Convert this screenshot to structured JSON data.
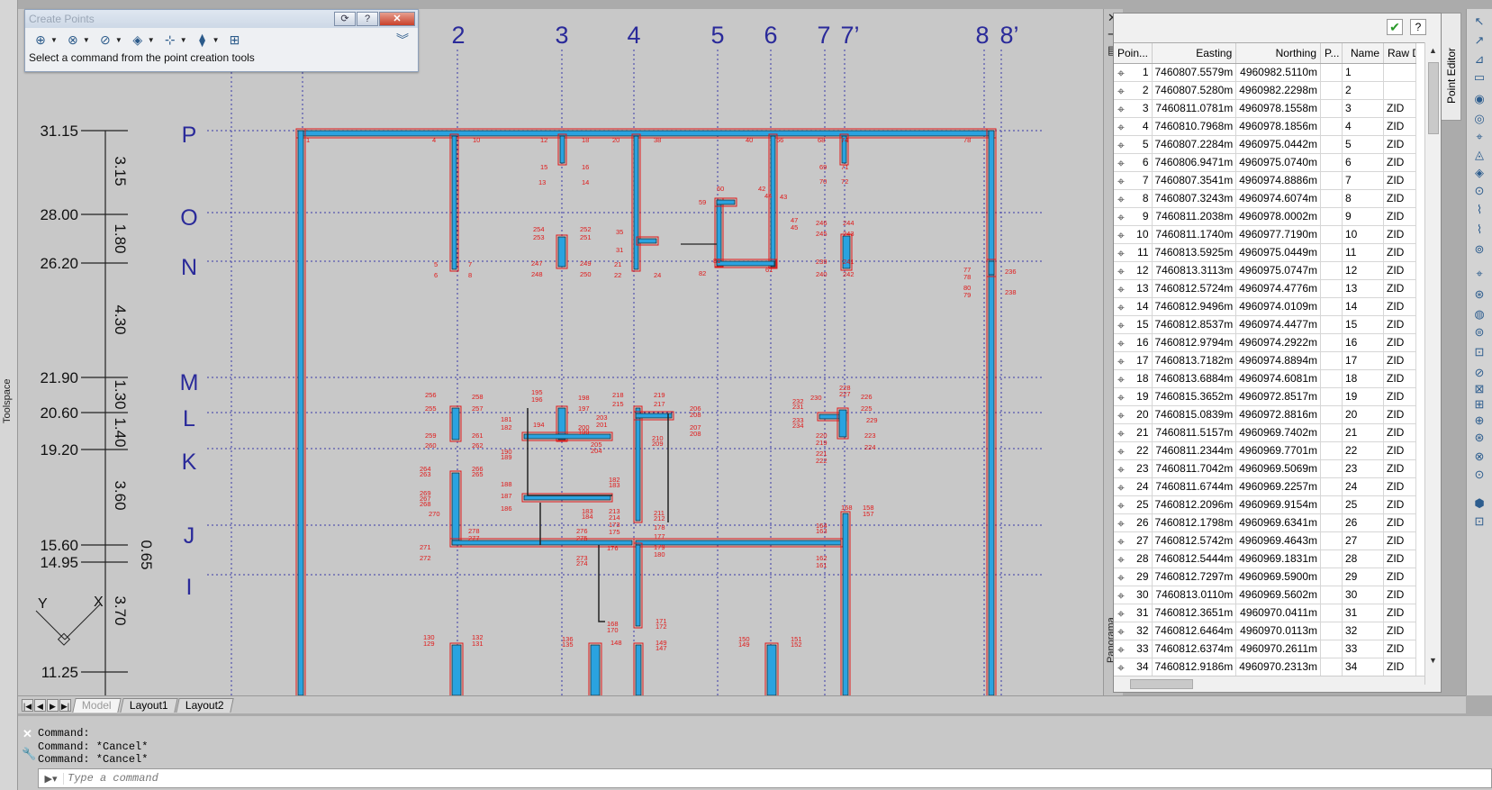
{
  "toolspace_label": "Toolspace",
  "create_points": {
    "title": "Create Points",
    "prompt": "Select a command from the point creation tools",
    "tools": [
      {
        "icon": "miscellaneous-points-icon"
      },
      {
        "icon": "intersection-points-icon"
      },
      {
        "icon": "alignment-points-icon"
      },
      {
        "icon": "surface-points-icon"
      },
      {
        "icon": "interpolate-points-icon"
      },
      {
        "icon": "slope-points-icon"
      },
      {
        "icon": "import-points-icon"
      }
    ]
  },
  "drawing": {
    "grid_columns": [
      "2",
      "3",
      "4",
      "5",
      "6",
      "7",
      "7’",
      "8",
      "8’"
    ],
    "grid_rows": [
      "P",
      "O",
      "N",
      "M",
      "L",
      "K",
      "J",
      "I"
    ],
    "elevations": [
      "31.15",
      "28.00",
      "26.20",
      "21.90",
      "20.60",
      "19.20",
      "15.60",
      "14.95",
      "11.25"
    ],
    "spacings": [
      "3.15",
      "1.80",
      "4.30",
      "1.30",
      "1.40",
      "3.60",
      "0.65",
      "3.70"
    ],
    "ucs_labels": [
      "Y",
      "X"
    ]
  },
  "panorama_label": "Panorama",
  "point_editor": {
    "title": "Point Editor",
    "columns": [
      "Poin...",
      "Easting",
      "Northing",
      "P...",
      "Name",
      "Raw D"
    ],
    "rows": [
      [
        "1",
        "7460807.5579m",
        "4960982.5110m",
        "1",
        ""
      ],
      [
        "2",
        "7460807.5280m",
        "4960982.2298m",
        "2",
        ""
      ],
      [
        "3",
        "7460811.0781m",
        "4960978.1558m",
        "3",
        "ZID"
      ],
      [
        "4",
        "7460810.7968m",
        "4960978.1856m",
        "4",
        "ZID"
      ],
      [
        "5",
        "7460807.2284m",
        "4960975.0442m",
        "5",
        "ZID"
      ],
      [
        "6",
        "7460806.9471m",
        "4960975.0740m",
        "6",
        "ZID"
      ],
      [
        "7",
        "7460807.3541m",
        "4960974.8886m",
        "7",
        "ZID"
      ],
      [
        "8",
        "7460807.3243m",
        "4960974.6074m",
        "8",
        "ZID"
      ],
      [
        "9",
        "7460811.2038m",
        "4960978.0002m",
        "9",
        "ZID"
      ],
      [
        "10",
        "7460811.1740m",
        "4960977.7190m",
        "10",
        "ZID"
      ],
      [
        "11",
        "7460813.5925m",
        "4960975.0449m",
        "11",
        "ZID"
      ],
      [
        "12",
        "7460813.3113m",
        "4960975.0747m",
        "12",
        "ZID"
      ],
      [
        "13",
        "7460812.5724m",
        "4960974.4776m",
        "13",
        "ZID"
      ],
      [
        "14",
        "7460812.9496m",
        "4960974.0109m",
        "14",
        "ZID"
      ],
      [
        "15",
        "7460812.8537m",
        "4960974.4477m",
        "15",
        "ZID"
      ],
      [
        "16",
        "7460812.9794m",
        "4960974.2922m",
        "16",
        "ZID"
      ],
      [
        "17",
        "7460813.7182m",
        "4960974.8894m",
        "17",
        "ZID"
      ],
      [
        "18",
        "7460813.6884m",
        "4960974.6081m",
        "18",
        "ZID"
      ],
      [
        "19",
        "7460815.3652m",
        "4960972.8517m",
        "19",
        "ZID"
      ],
      [
        "20",
        "7460815.0839m",
        "4960972.8816m",
        "20",
        "ZID"
      ],
      [
        "21",
        "7460811.5157m",
        "4960969.7402m",
        "21",
        "ZID"
      ],
      [
        "22",
        "7460811.2344m",
        "4960969.7701m",
        "22",
        "ZID"
      ],
      [
        "23",
        "7460811.7042m",
        "4960969.5069m",
        "23",
        "ZID"
      ],
      [
        "24",
        "7460811.6744m",
        "4960969.2257m",
        "24",
        "ZID"
      ],
      [
        "25",
        "7460812.2096m",
        "4960969.9154m",
        "25",
        "ZID"
      ],
      [
        "26",
        "7460812.1798m",
        "4960969.6341m",
        "26",
        "ZID"
      ],
      [
        "27",
        "7460812.5742m",
        "4960969.4643m",
        "27",
        "ZID"
      ],
      [
        "28",
        "7460812.5444m",
        "4960969.1831m",
        "28",
        "ZID"
      ],
      [
        "29",
        "7460812.7297m",
        "4960969.5900m",
        "29",
        "ZID"
      ],
      [
        "30",
        "7460813.0110m",
        "4960969.5602m",
        "30",
        "ZID"
      ],
      [
        "31",
        "7460812.3651m",
        "4960970.0411m",
        "31",
        "ZID"
      ],
      [
        "32",
        "7460812.6464m",
        "4960970.0113m",
        "32",
        "ZID"
      ],
      [
        "33",
        "7460812.6374m",
        "4960970.2611m",
        "33",
        "ZID"
      ],
      [
        "34",
        "7460812.9186m",
        "4960970.2313m",
        "34",
        "ZID"
      ]
    ]
  },
  "layout_tabs": [
    "Model",
    "Layout1",
    "Layout2"
  ],
  "command": {
    "history": [
      "Command:",
      "Command: *Cancel*",
      "Command: *Cancel*"
    ],
    "placeholder": "Type a command"
  }
}
